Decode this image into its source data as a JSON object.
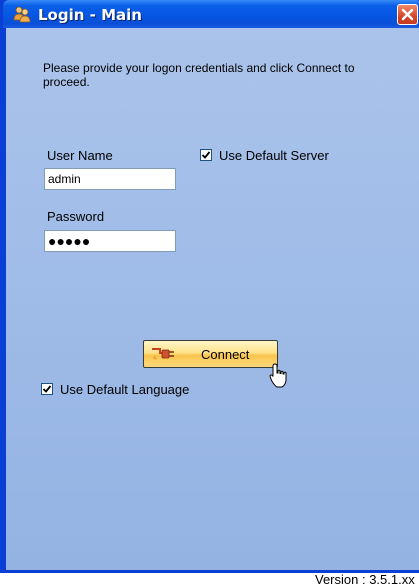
{
  "window": {
    "title": "Login - Main"
  },
  "instructions": "Please provide your logon credentials and click Connect to proceed.",
  "form": {
    "username_label": "User Name",
    "username_value": "admin",
    "password_label": "Password",
    "password_value": "●●●●●",
    "default_server_label": "Use Default Server",
    "default_server_checked": true,
    "default_language_label": "Use Default Language",
    "default_language_checked": true
  },
  "connect_label": "Connect",
  "version": "Version : 3.5.1.xx",
  "icons": {
    "title": "users-icon",
    "close": "close-icon",
    "connect": "connect-plug-icon",
    "cursor": "hand-pointer-icon"
  },
  "colors": {
    "titlebar": "#0a5fe8",
    "client": "#a0bce8",
    "button": "#ffe28a",
    "close": "#d6452a"
  }
}
